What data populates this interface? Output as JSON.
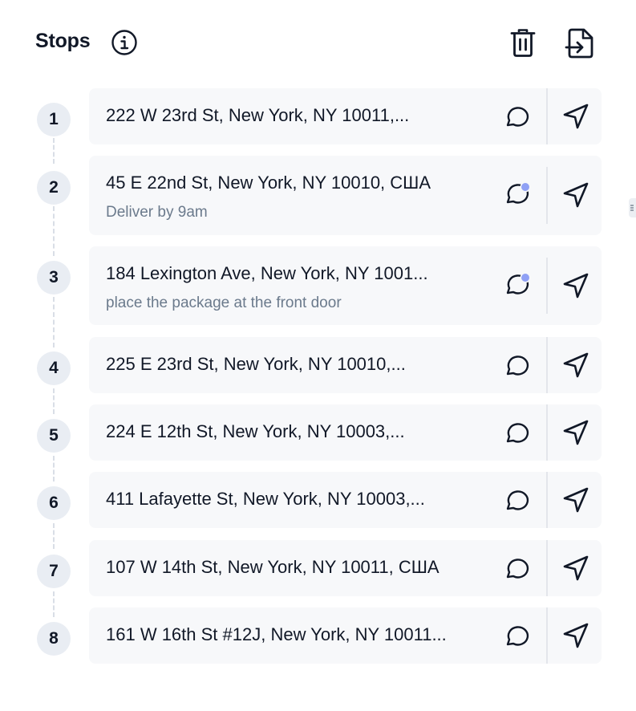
{
  "header": {
    "title": "Stops",
    "info_icon": "info-icon",
    "delete_icon": "trash-icon",
    "export_icon": "file-export-icon"
  },
  "colors": {
    "badge_bg": "#e9edf3",
    "card_bg": "#f7f8fa",
    "note_text": "#6b7a8c",
    "unread_dot": "#8fa0f5"
  },
  "stops": [
    {
      "number": "1",
      "address": "222 W 23rd St, New York, NY 10011,...",
      "note": "",
      "has_unread_comment": false
    },
    {
      "number": "2",
      "address": "45 E 22nd St, New York, NY 10010, США",
      "note": "Deliver by 9am",
      "has_unread_comment": true
    },
    {
      "number": "3",
      "address": "184 Lexington Ave, New York, NY 1001...",
      "note": "place the package at the front door",
      "has_unread_comment": true
    },
    {
      "number": "4",
      "address": "225 E 23rd St, New York, NY 10010,...",
      "note": "",
      "has_unread_comment": false
    },
    {
      "number": "5",
      "address": "224 E 12th St, New York, NY 10003,...",
      "note": "",
      "has_unread_comment": false
    },
    {
      "number": "6",
      "address": "411 Lafayette St, New York, NY 10003,...",
      "note": "",
      "has_unread_comment": false
    },
    {
      "number": "7",
      "address": "107 W 14th St, New York, NY 10011, США",
      "note": "",
      "has_unread_comment": false
    },
    {
      "number": "8",
      "address": "161 W 16th St #12J, New York, NY 10011...",
      "note": "",
      "has_unread_comment": false
    }
  ]
}
